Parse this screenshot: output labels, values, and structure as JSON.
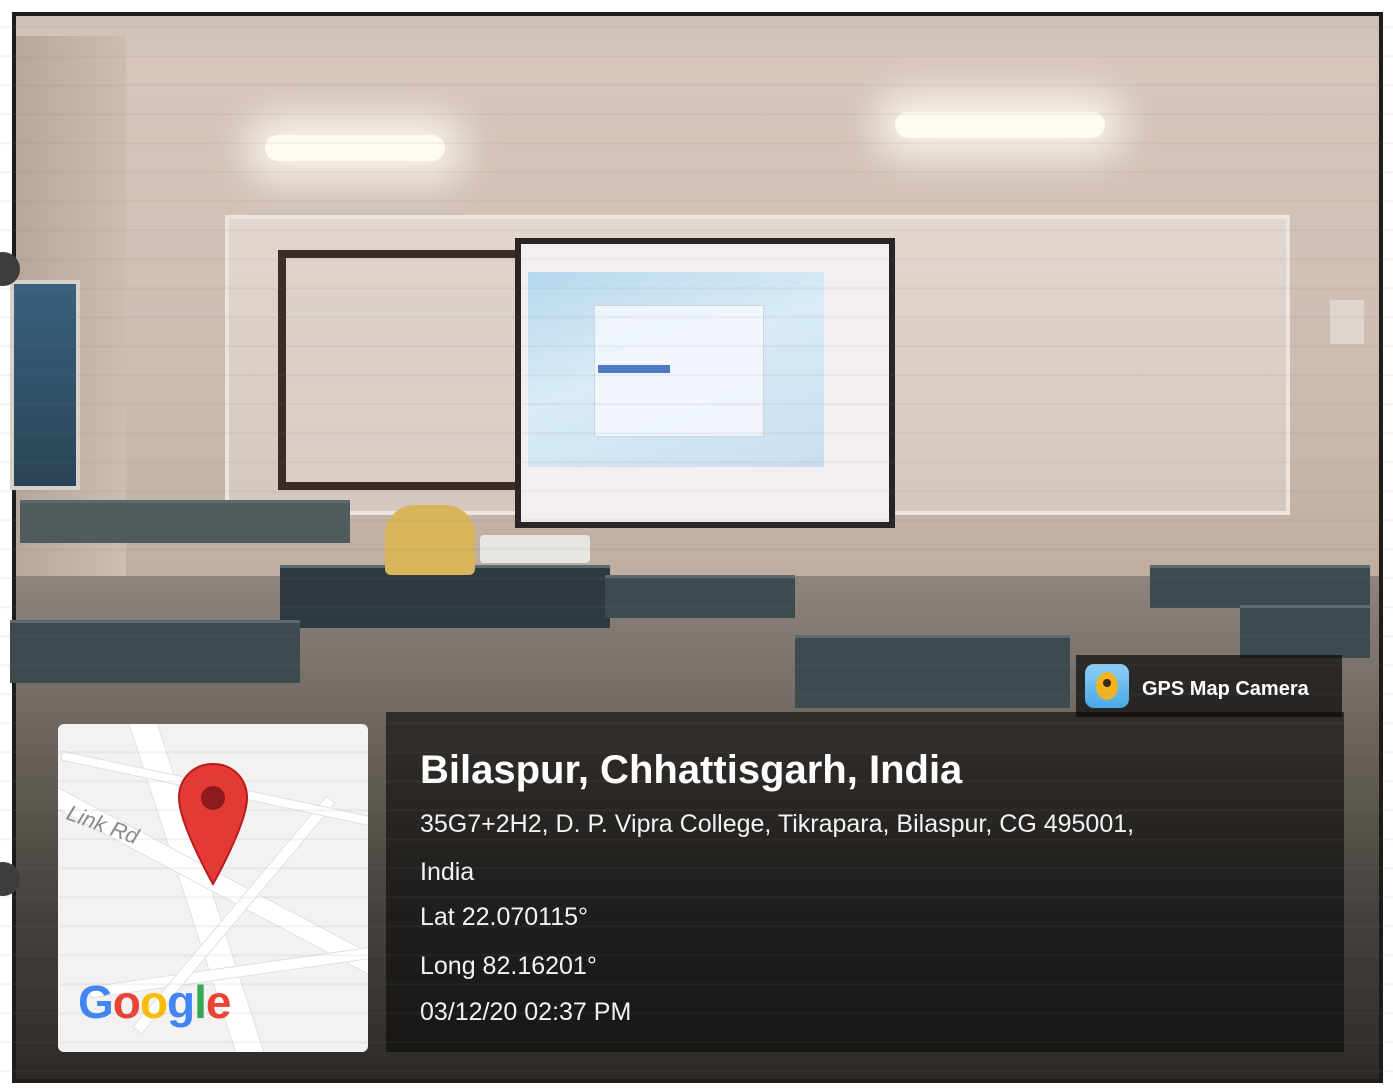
{
  "overlay": {
    "address_title": "Bilaspur, Chhattisgarh, India",
    "address_line1": "35G7+2H2, D. P. Vipra College, Tikrapara, Bilaspur, CG 495001,",
    "address_line2": "India",
    "latitude": "Lat 22.070115°",
    "longitude": "Long 82.16201°",
    "timestamp": "03/12/20 02:37 PM"
  },
  "badge": {
    "label": "GPS Map Camera",
    "icon": "map-pin-icon"
  },
  "map": {
    "road_label": "Link Rd",
    "pin_icon": "location-pin-icon",
    "pin_color": "#e53935",
    "logo": {
      "letters": [
        "G",
        "o",
        "o",
        "g",
        "l",
        "e"
      ]
    }
  }
}
